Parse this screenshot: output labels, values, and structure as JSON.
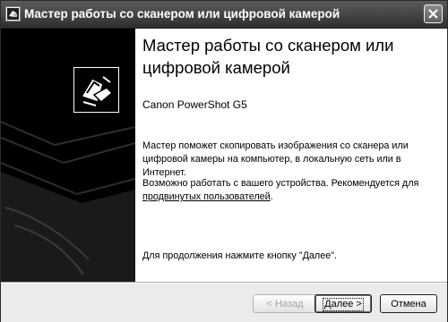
{
  "window": {
    "title": "Мастер работы со сканером или цифровой камерой"
  },
  "content": {
    "heading": "Мастер работы со сканером или цифровой камерой",
    "device_name": "Canon PowerShot G5",
    "description": "Мастер поможет скопировать изображения со сканера или цифровой камеры на компьютер, в локальную сеть или в Интернет.",
    "advice_text": "Возможно работать с вашего устройства. Рекомендуется для",
    "advice_link": "продвинутых пользователей",
    "advice_end": ".",
    "continue_text": "Для продолжения нажмите кнопку \"Далее\"."
  },
  "buttons": {
    "back": "< Назад",
    "next": "Далее >",
    "cancel": "Отмена"
  },
  "icons": {
    "title": "wizard-window-icon",
    "close": "close-icon",
    "logo": "scanner-camera-wizard-logo"
  }
}
